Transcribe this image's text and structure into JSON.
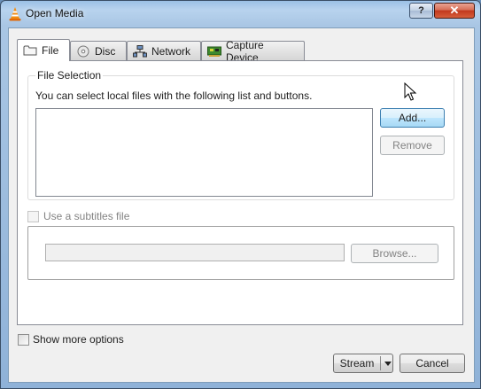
{
  "window": {
    "title": "Open Media",
    "help_label": "?",
    "close_label": "✕",
    "app_icon": "vlc-cone-icon"
  },
  "tabs": [
    {
      "label": "File",
      "icon": "folder-icon",
      "active": true
    },
    {
      "label": "Disc",
      "icon": "disc-icon",
      "active": false
    },
    {
      "label": "Network",
      "icon": "network-icon",
      "active": false
    },
    {
      "label": "Capture Device",
      "icon": "capture-card-icon",
      "active": false
    }
  ],
  "file_selection": {
    "group_title": "File Selection",
    "hint": "You can select local files with the following list and buttons.",
    "files": [],
    "add_label": "Add...",
    "remove_label": "Remove"
  },
  "subtitles": {
    "checkbox_label": "Use a subtitles file",
    "checked": false,
    "enabled": false,
    "path_value": "",
    "browse_label": "Browse..."
  },
  "footer": {
    "more_options_label": "Show more options",
    "more_options_checked": false,
    "stream_label": "Stream",
    "cancel_label": "Cancel"
  },
  "colors": {
    "title_bar": "#a9c6e4",
    "close_button": "#c2381d",
    "hover_button": "#bee6fd"
  }
}
